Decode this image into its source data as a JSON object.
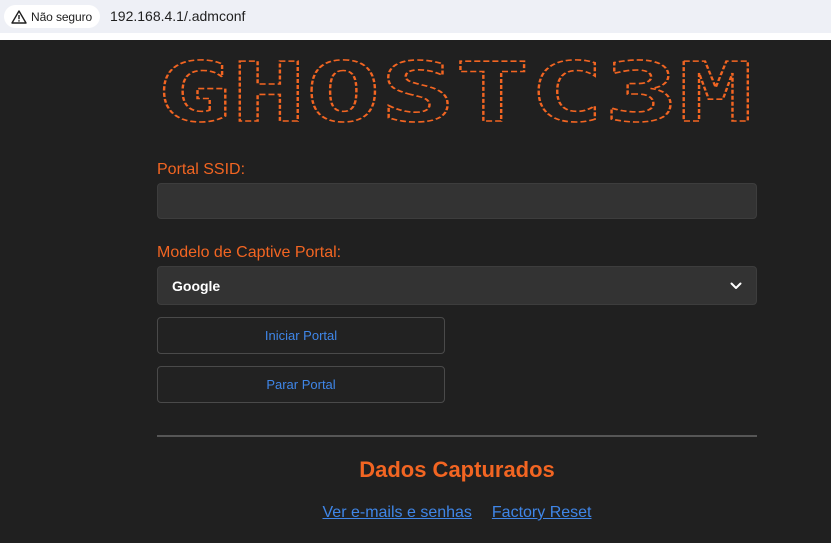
{
  "browser": {
    "security_label": "Não seguro",
    "url": "192.168.4.1/.admconf"
  },
  "banner": {
    "text": "GHOSTC3M",
    "color": "#f26522"
  },
  "form": {
    "ssid_label": "Portal SSID:",
    "ssid_value": "",
    "template_label": "Modelo de Captive Portal:",
    "template_selected": "Google",
    "start_label": "Iniciar Portal",
    "stop_label": "Parar Portal"
  },
  "captured": {
    "title": "Dados Capturados",
    "links": [
      "Ver e-mails e senhas",
      "Factory Reset"
    ]
  },
  "colors": {
    "accent": "#f26522",
    "link": "#3f86e8",
    "background": "#202020"
  }
}
